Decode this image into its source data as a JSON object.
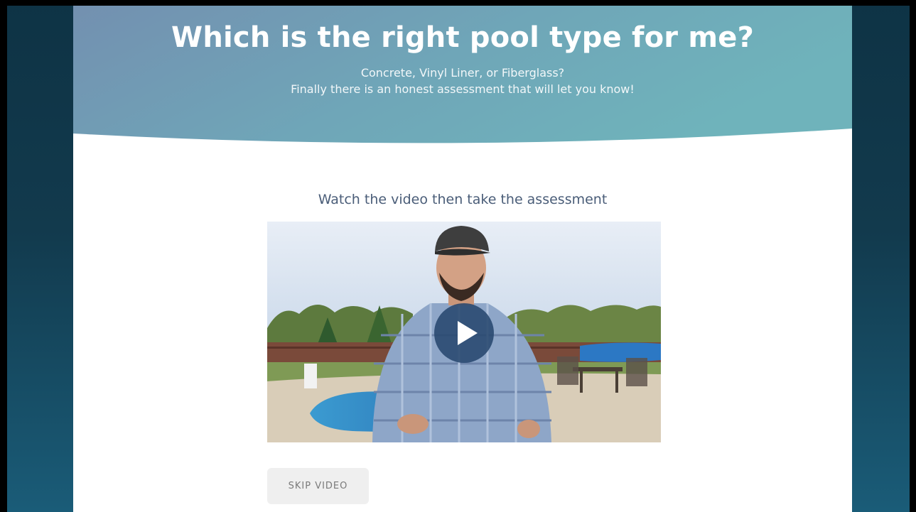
{
  "hero": {
    "title": "Which is the right pool type for me?",
    "subtitle_line1": "Concrete, Vinyl Liner, or Fiberglass?",
    "subtitle_line2": "Finally there is an honest assessment that will let you know!"
  },
  "main": {
    "prompt": "Watch the video then take the assessment",
    "skip_label": "SKIP VIDEO"
  },
  "video": {
    "icon": "play-icon",
    "state": "paused"
  },
  "colors": {
    "hero_left": "#7390b0",
    "hero_right": "#6fb3bb",
    "play_button": "#28486e",
    "skip_bg": "#efefef",
    "accent_orange": "#f28a2e"
  }
}
